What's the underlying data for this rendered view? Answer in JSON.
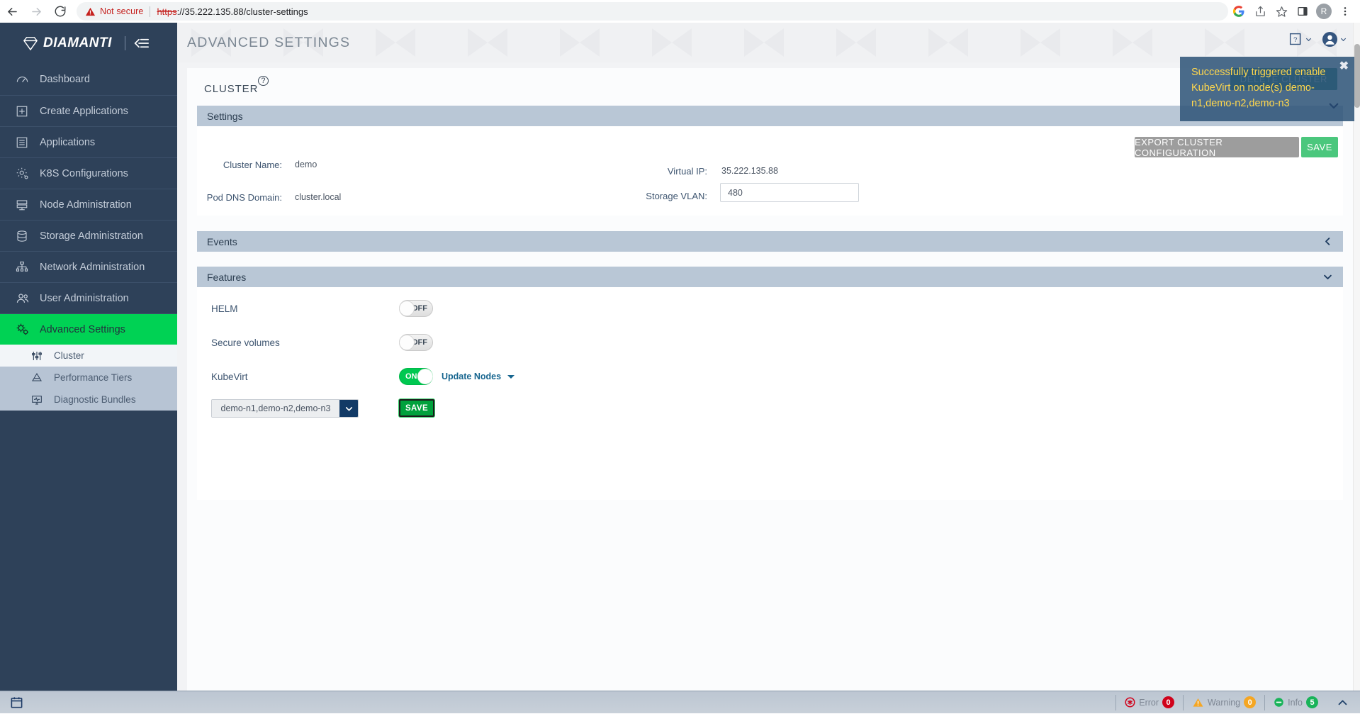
{
  "browser": {
    "back_icon": "back-arrow-icon",
    "forward_icon": "forward-arrow-icon",
    "reload_icon": "reload-icon",
    "security_label": "Not secure",
    "url_scheme": "https",
    "url_rest": "://35.222.135.88/cluster-settings",
    "profile_initial": "R",
    "icons": [
      "google-icon",
      "share-icon",
      "bookmark-star-icon",
      "side-panel-icon",
      "profile-avatar",
      "more-menu-icon"
    ]
  },
  "sidebar": {
    "brand": "DIAMANTI",
    "collapse_icon": "collapse-sidebar-icon",
    "items": [
      {
        "label": "Dashboard",
        "icon": "dashboard-gauge-icon"
      },
      {
        "label": "Create Applications",
        "icon": "plus-square-icon"
      },
      {
        "label": "Applications",
        "icon": "list-document-icon"
      },
      {
        "label": "K8S Configurations",
        "icon": "gear-icon"
      },
      {
        "label": "Node Administration",
        "icon": "server-node-icon"
      },
      {
        "label": "Storage Administration",
        "icon": "database-icon"
      },
      {
        "label": "Network Administration",
        "icon": "network-tree-icon"
      },
      {
        "label": "User Administration",
        "icon": "users-icon"
      },
      {
        "label": "Advanced Settings",
        "icon": "cogs-icon"
      }
    ],
    "sub_items": [
      {
        "label": "Cluster",
        "icon": "sliders-icon"
      },
      {
        "label": "Performance Tiers",
        "icon": "layers-icon"
      },
      {
        "label": "Diagnostic Bundles",
        "icon": "monitor-pulse-icon"
      }
    ]
  },
  "header": {
    "title": "ADVANCED SETTINGS",
    "help_icon": "help-book-icon",
    "user_icon": "user-avatar-icon",
    "chevron_icon": "chevron-down-icon"
  },
  "card": {
    "title": "CLUSTER",
    "title_sup": "?"
  },
  "sections": {
    "settings": {
      "title": "Settings",
      "fields": [
        {
          "label": "Cluster Name:",
          "value": "demo"
        },
        {
          "label": "Pod DNS Domain:",
          "value": "cluster.local"
        },
        {
          "label": "Virtual IP:",
          "value": "35.222.135.88"
        },
        {
          "label": "Storage VLAN:",
          "value": "480"
        }
      ],
      "export_button": "EXPORT CLUSTER CONFIGURATION",
      "save_button": "SAVE"
    },
    "events": {
      "title": "Events",
      "chevron": "chevron-left-icon"
    },
    "features": {
      "title": "Features",
      "chevron": "chevron-down-icon",
      "rows": [
        {
          "label": "HELM",
          "state": "OFF"
        },
        {
          "label": "Secure volumes",
          "state": "OFF"
        },
        {
          "label": "KubeVirt",
          "state": "ON"
        }
      ],
      "update_nodes_label": "Update Nodes",
      "node_select_value": "demo-n1,demo-n2,demo-n3",
      "node_save_button": "SAVE"
    }
  },
  "toast": {
    "message": "Successfully triggered enable KubeVirt on node(s) demo-n1,demo-n2,demo-n3",
    "close_icon": "close-icon",
    "behind_button": "DELETE CLUSTER"
  },
  "footer": {
    "calendar_icon": "calendar-icon",
    "statuses": [
      {
        "label": "Error",
        "count": "0",
        "color": "#d0021b",
        "icon": "error-icon"
      },
      {
        "label": "Warning",
        "count": "0",
        "color": "#f5a623",
        "icon": "warning-icon"
      },
      {
        "label": "Info",
        "count": "5",
        "color": "#19b359",
        "icon": "info-icon"
      }
    ],
    "expand_icon": "chevron-up-icon"
  },
  "colors": {
    "brand_navy": "#2e4159",
    "accent_green": "#00d254",
    "section_bar": "#b9c7d6",
    "save_green": "#4bc77d"
  }
}
